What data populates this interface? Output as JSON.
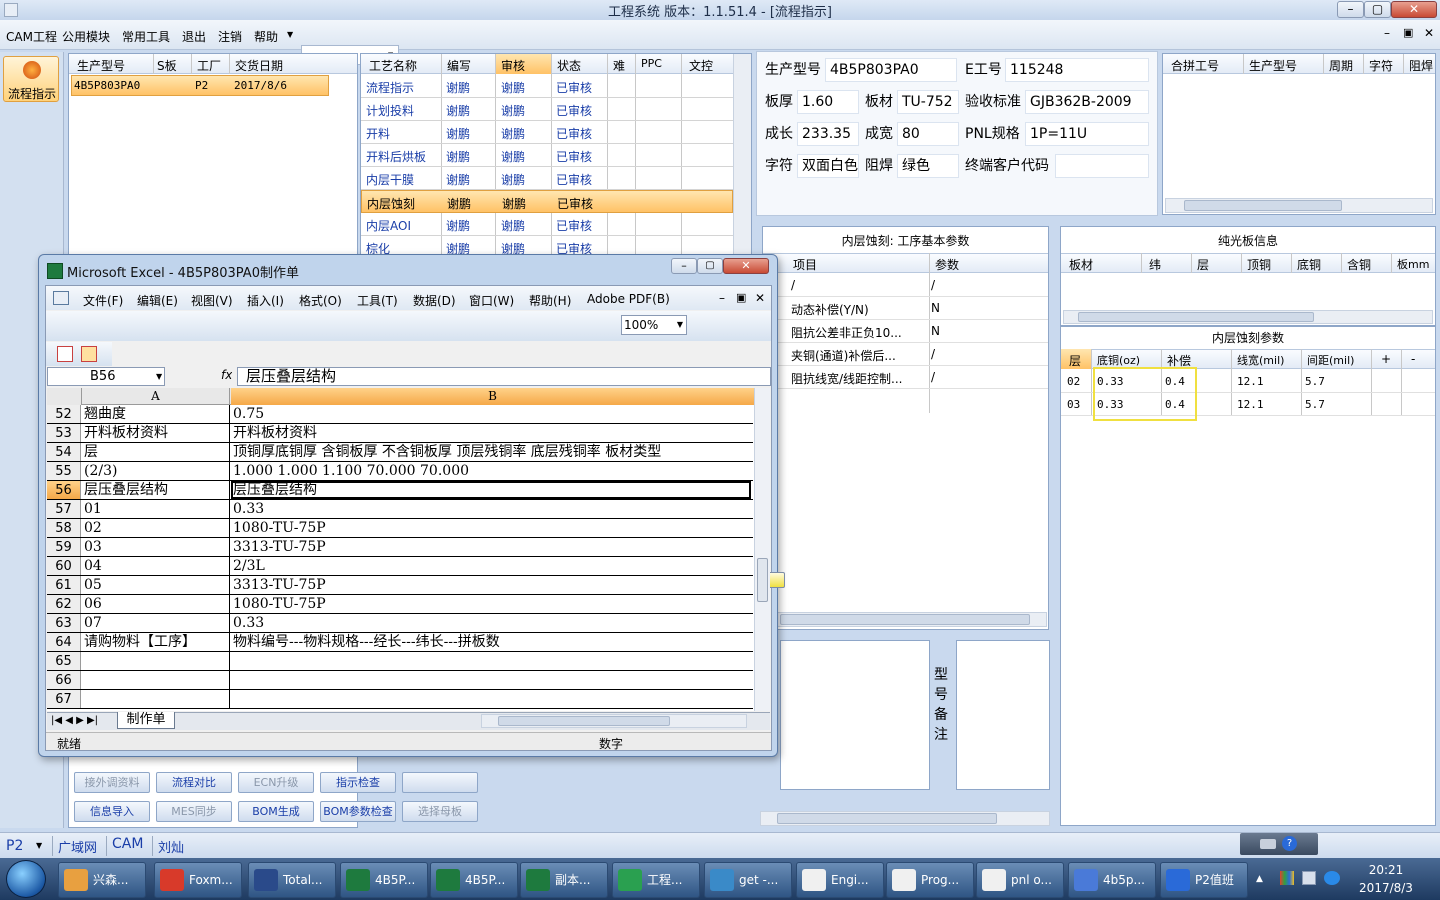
{
  "window": {
    "title": "工程系统   版本：1.1.51.4 - [流程指示]"
  },
  "menu": [
    "CAM工程",
    "公用模块",
    "常用工具",
    "退出",
    "注销",
    "帮助"
  ],
  "sidebar": {
    "flow_label": "流程指示"
  },
  "orders": {
    "headers": [
      "生产型号",
      "S板",
      "工厂",
      "交货日期"
    ],
    "rows": [
      {
        "model": "4B5P803PA0",
        "s": "",
        "factory": "P2",
        "date": "2017/8/6"
      }
    ]
  },
  "process": {
    "headers": [
      "工艺名称",
      "编写",
      "审核",
      "状态",
      "难",
      "PPC",
      "文控"
    ],
    "rows": [
      {
        "name": "流程指示",
        "w": "谢鹏",
        "r": "谢鹏",
        "s": "已审核"
      },
      {
        "name": "计划投料",
        "w": "谢鹏",
        "r": "谢鹏",
        "s": "已审核"
      },
      {
        "name": "开料",
        "w": "谢鹏",
        "r": "谢鹏",
        "s": "已审核"
      },
      {
        "name": "开料后烘板",
        "w": "谢鹏",
        "r": "谢鹏",
        "s": "已审核"
      },
      {
        "name": "内层干膜",
        "w": "谢鹏",
        "r": "谢鹏",
        "s": "已审核"
      },
      {
        "name": "内层蚀刻",
        "w": "谢鹏",
        "r": "谢鹏",
        "s": "已审核"
      },
      {
        "name": "内层AOI",
        "w": "谢鹏",
        "r": "谢鹏",
        "s": "已审核"
      },
      {
        "name": "棕化",
        "w": "谢鹏",
        "r": "谢鹏",
        "s": "已审核"
      }
    ]
  },
  "info": {
    "model_label": "生产型号",
    "model": "4B5P803PA0",
    "eno_label": "E工号",
    "eno": "115248",
    "thick_label": "板厚",
    "thick": "1.60",
    "material_label": "板材",
    "material": "TU-752",
    "std_label": "验收标准",
    "std": "GJB362B-2009",
    "len_label": "成长",
    "len": "233.35",
    "width_label": "成宽",
    "width": "80",
    "pnl_label": "PNL规格",
    "pnl": "1P=11U",
    "char_label": "字符",
    "char": "双面白色",
    "mask_label": "阻焊",
    "mask": "绿色",
    "cust_label": "终端客户代码",
    "cust": ""
  },
  "merge": {
    "headers": [
      "合拼工号",
      "生产型号",
      "周期",
      "字符",
      "阻焊"
    ]
  },
  "etch": {
    "title": "内层蚀刻: 工序基本参数",
    "headers": [
      "项目",
      "参数"
    ],
    "rows": [
      {
        "item": "/",
        "val": "/"
      },
      {
        "item": "动态补偿(Y/N)",
        "val": "N"
      },
      {
        "item": "阻抗公差非正负10...",
        "val": "N"
      },
      {
        "item": "夹铜(通道)补偿后...",
        "val": "/"
      },
      {
        "item": "阻抗线宽/线距控制...",
        "val": "/"
      }
    ]
  },
  "remark": {
    "label": "型号备注"
  },
  "pure": {
    "title": "纯光板信息",
    "headers": [
      "板材",
      "纬",
      "层",
      "顶铜",
      "底铜",
      "含铜",
      "板mm"
    ]
  },
  "inner": {
    "title": "内层蚀刻参数",
    "headers": [
      "层",
      "底铜(oz)",
      "补偿",
      "线宽(mil)",
      "间距(mil)",
      "+",
      "-"
    ],
    "rows": [
      {
        "layer": "02",
        "cu": "0.33",
        "comp": "0.4",
        "lw": "12.1",
        "sp": "5.7"
      },
      {
        "layer": "03",
        "cu": "0.33",
        "comp": "0.4",
        "lw": "12.1",
        "sp": "5.7"
      }
    ]
  },
  "buttons": {
    "row1": [
      "接外调资料",
      "流程对比",
      "ECN升级",
      "指示检查",
      ""
    ],
    "row2": [
      "信息导入",
      "MES同步",
      "BOM生成",
      "BOM参数检查",
      "选择母板"
    ]
  },
  "status": {
    "p2": "P2",
    "wan": "广域网",
    "cam": "CAM",
    "user": "刘灿"
  },
  "excel": {
    "title": "Microsoft Excel - 4B5P803PA0制作单",
    "menu": [
      "文件(F)",
      "编辑(E)",
      "视图(V)",
      "插入(I)",
      "格式(O)",
      "工具(T)",
      "数据(D)",
      "窗口(W)",
      "帮助(H)",
      "Adobe PDF(B)"
    ],
    "zoom": "100%",
    "namebox": "B56",
    "formula": "层压叠层结构",
    "colA": "A",
    "colB": "B",
    "rows": [
      {
        "n": "52",
        "a": "翘曲度",
        "b": "0.75"
      },
      {
        "n": "53",
        "a": "开料板材资料",
        "b": "开料板材资料"
      },
      {
        "n": "54",
        "a": "层",
        "b": "顶铜厚底铜厚  含铜板厚  不含铜板厚  顶层残铜率  底层残铜率  板材类型"
      },
      {
        "n": "55",
        "a": "(2/3)",
        "b": "1.000   1.000   1.100             70.000      70.000"
      },
      {
        "n": "56",
        "a": "层压叠层结构",
        "b": "层压叠层结构"
      },
      {
        "n": "57",
        "a": "01",
        "b": "0.33"
      },
      {
        "n": "58",
        "a": "02",
        "b": "1080-TU-75P"
      },
      {
        "n": "59",
        "a": "03",
        "b": "3313-TU-75P"
      },
      {
        "n": "60",
        "a": "04",
        "b": "2/3L"
      },
      {
        "n": "61",
        "a": "05",
        "b": "3313-TU-75P"
      },
      {
        "n": "62",
        "a": "06",
        "b": "1080-TU-75P"
      },
      {
        "n": "63",
        "a": "07",
        "b": "0.33"
      },
      {
        "n": "64",
        "a": "请购物料【工序】",
        "b": "物料编号---物料规格---经长---纬长---拼板数"
      },
      {
        "n": "65",
        "a": "",
        "b": ""
      },
      {
        "n": "66",
        "a": "",
        "b": ""
      },
      {
        "n": "67",
        "a": "",
        "b": ""
      }
    ],
    "sheet_tab": "制作单",
    "status_ready": "就绪",
    "status_num": "数字"
  },
  "taskbar": {
    "items": [
      "兴森...",
      "Foxm...",
      "Total...",
      "4B5P...",
      "4B5P...",
      "副本...",
      "工程...",
      "get -...",
      "Engi...",
      "Prog...",
      "pnl o...",
      "4b5p...",
      "P2值班"
    ],
    "time": "20:21",
    "date": "2017/8/3"
  }
}
